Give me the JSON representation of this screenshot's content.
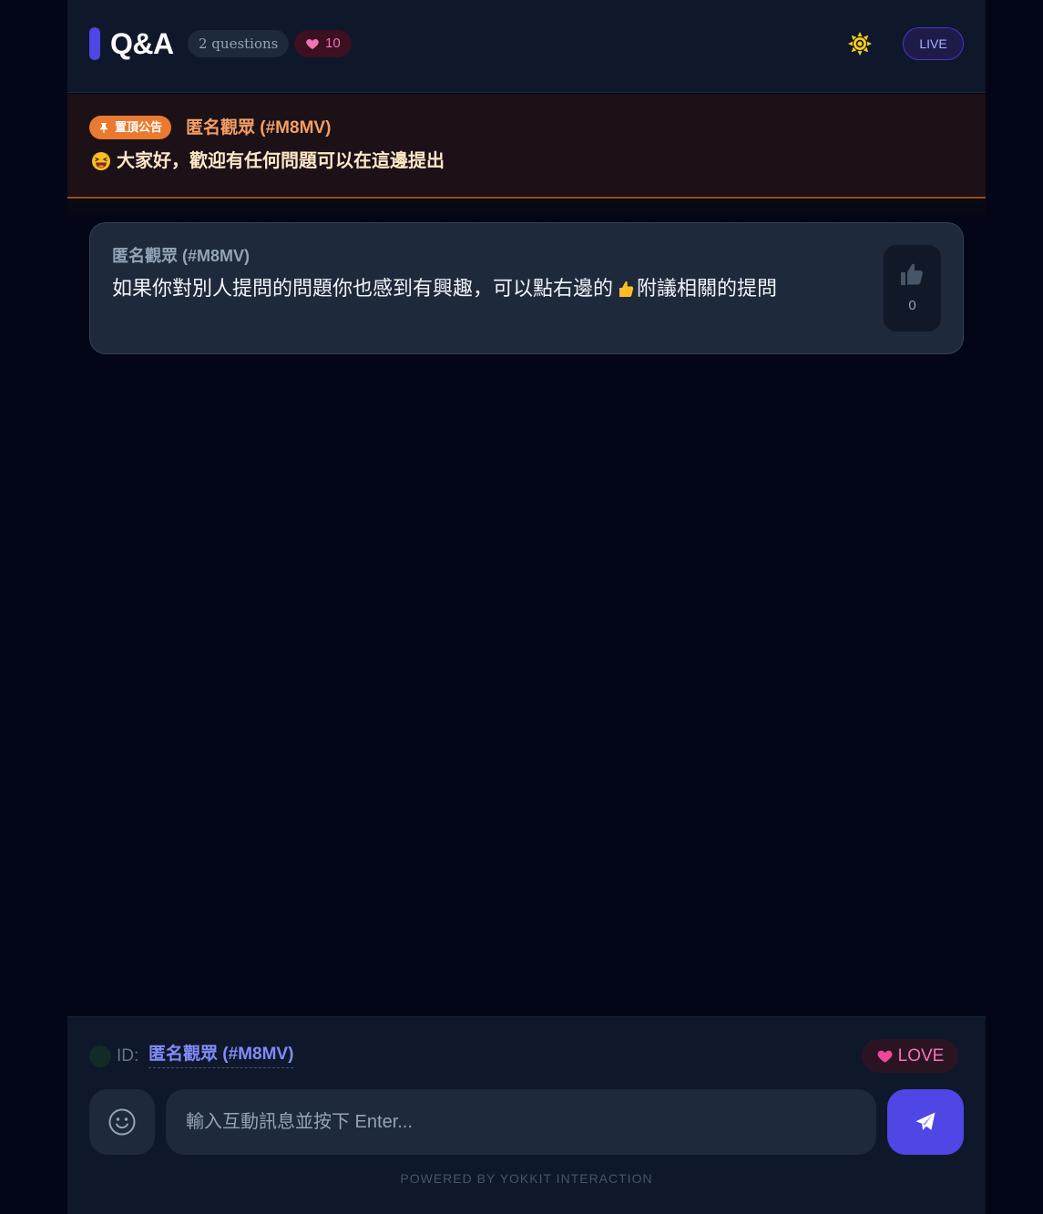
{
  "header": {
    "title": "Q&A",
    "question_count": "2 questions",
    "likes_count": "10",
    "theme_icon": "sun-icon",
    "live_label": "LIVE"
  },
  "pinned": {
    "tag_label": "置頂公告",
    "tag_icon": "pin-icon",
    "author": "匿名觀眾 (#M8MV)",
    "emoji": "laughing-face-emoji",
    "message": "大家好，歡迎有任何問題可以在這邊提出"
  },
  "questions": [
    {
      "author": "匿名觀眾 (#M8MV)",
      "text_before": "如果你對別人提問的問題你也感到有興趣，可以點右邊的",
      "inline_icon": "thumbs-up-emoji",
      "text_after": "附議相關的提問",
      "votes": "0"
    }
  ],
  "footer": {
    "id_label": "ID:",
    "id_value": "匿名觀眾 (#M8MV)",
    "love_label": "LOVE",
    "input_placeholder": "輸入互動訊息並按下 Enter...",
    "powered_by": "POWERED BY YOKKIT INTERACTION"
  },
  "colors": {
    "accent": "#4f46e5",
    "pinned_accent": "#ea7a2f",
    "love": "#f472b6",
    "background": "#020617",
    "panel": "#0f172a",
    "card": "#1e293b"
  }
}
